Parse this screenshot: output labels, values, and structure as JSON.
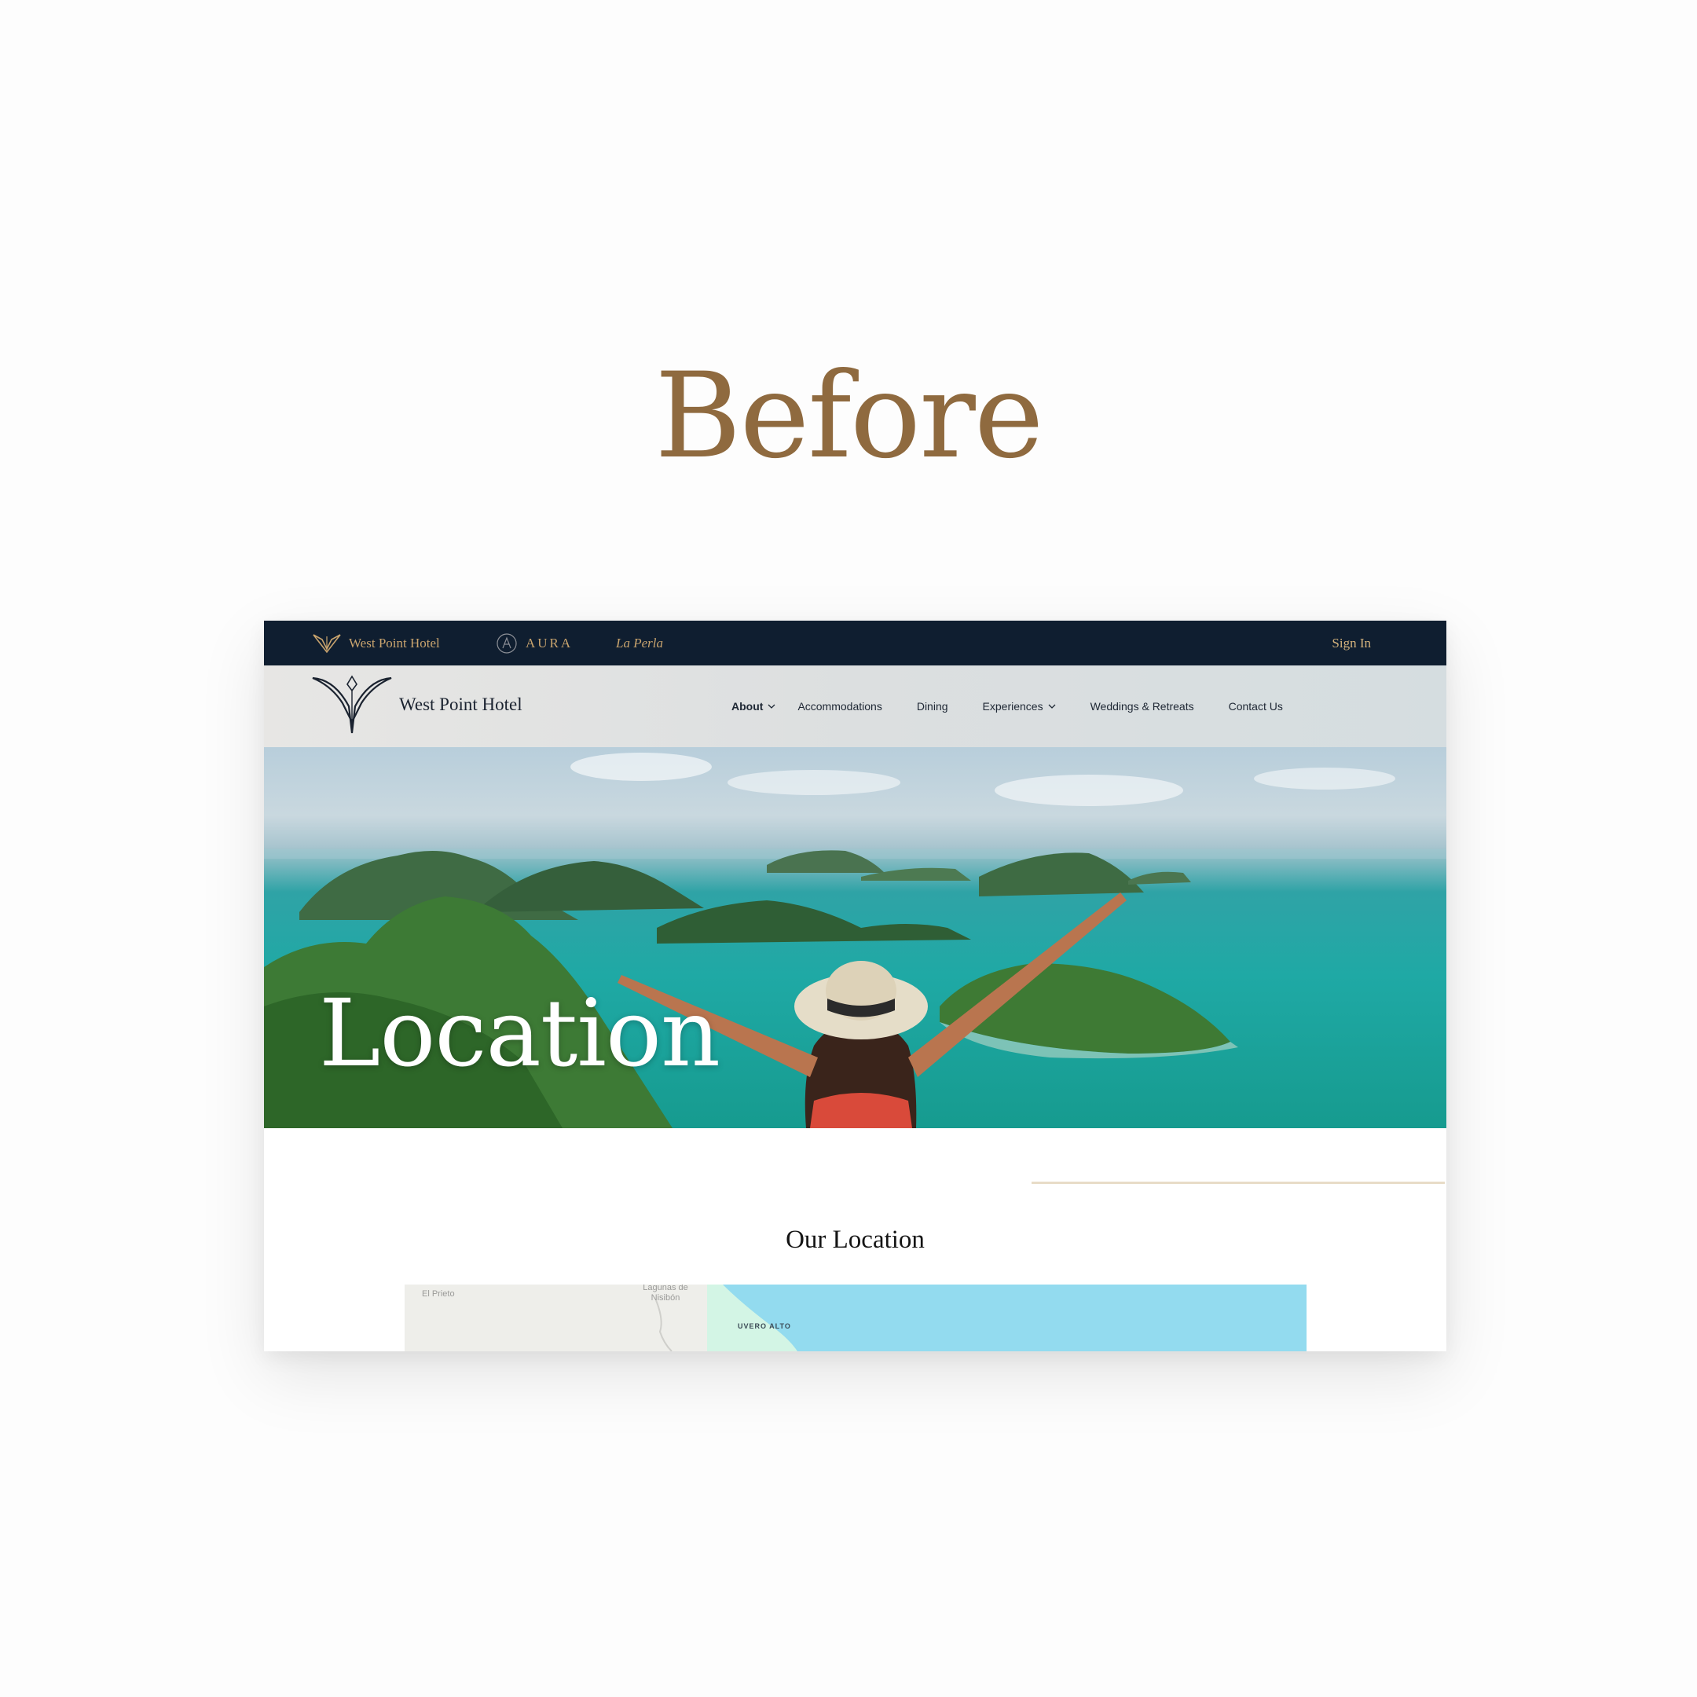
{
  "headline": "Before",
  "topbar": {
    "brands": [
      "West Point Hotel",
      "AURA",
      "La Perla"
    ],
    "sign_in": "Sign In"
  },
  "navbar": {
    "logo_text": "West Point Hotel",
    "items": [
      {
        "label": "About",
        "has_dropdown": true,
        "active": true
      },
      {
        "label": "Accommodations",
        "has_dropdown": false
      },
      {
        "label": "Dining",
        "has_dropdown": false
      },
      {
        "label": "Experiences",
        "has_dropdown": true
      },
      {
        "label": "Weddings & Retreats",
        "has_dropdown": false
      },
      {
        "label": "Contact Us",
        "has_dropdown": false
      }
    ]
  },
  "hero": {
    "title": "Location"
  },
  "location": {
    "title": "Our Location",
    "map_labels": [
      "El Prieto",
      "Lagunas de Nisibón",
      "UVERO ALTO"
    ]
  },
  "colors": {
    "headline": "#8f6a3f",
    "topbar_bg": "#0f1e30",
    "gold": "#c9a46e",
    "sea": "#1fa9a5"
  }
}
